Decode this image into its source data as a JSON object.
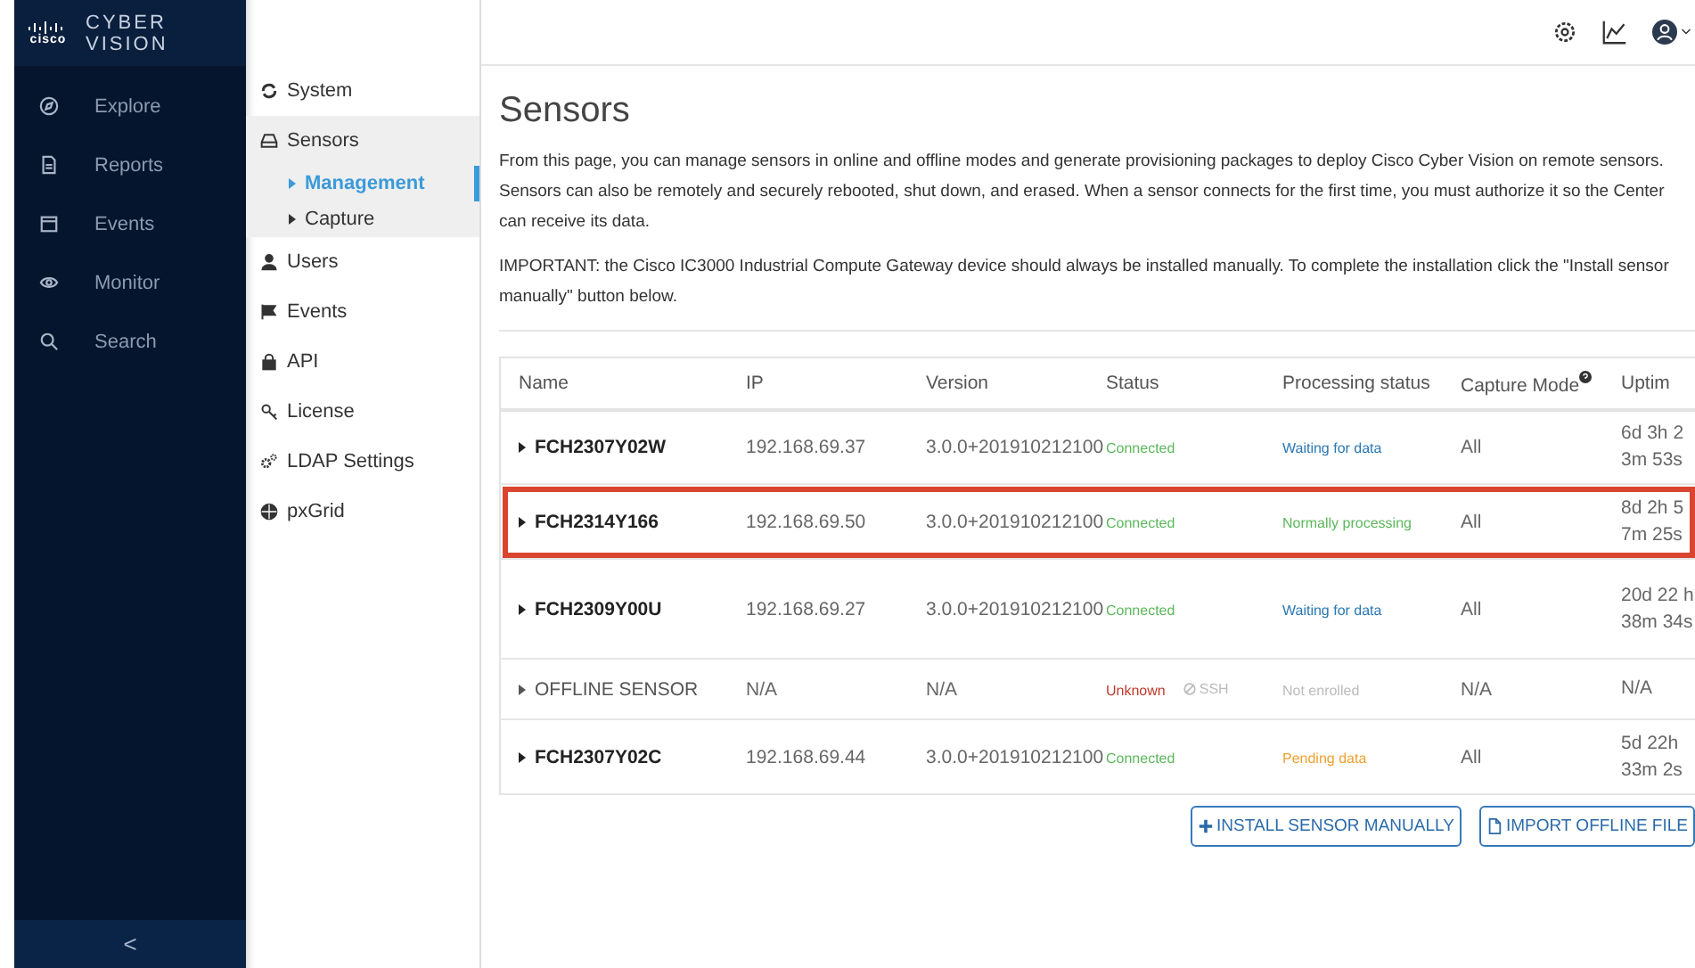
{
  "brand": {
    "logo": "cisco",
    "product": "CYBER VISION"
  },
  "nav": [
    {
      "label": "Explore"
    },
    {
      "label": "Reports"
    },
    {
      "label": "Events"
    },
    {
      "label": "Monitor"
    },
    {
      "label": "Search"
    }
  ],
  "collapse": "<",
  "settings_menu": [
    {
      "label": "System",
      "selected": false
    },
    {
      "label": "Sensors",
      "selected": false,
      "children": [
        {
          "label": "Management",
          "selected": true
        },
        {
          "label": "Capture",
          "selected": false
        }
      ]
    },
    {
      "label": "Users",
      "selected": false
    },
    {
      "label": "Events",
      "selected": false
    },
    {
      "label": "API",
      "selected": false
    },
    {
      "label": "License",
      "selected": false
    },
    {
      "label": "LDAP Settings",
      "selected": false
    },
    {
      "label": "pxGrid",
      "selected": false
    }
  ],
  "page": {
    "title": "Sensors",
    "paragraphs": [
      "From this page, you can manage sensors in online and offline modes and generate provisioning packages to deploy Cisco Cyber Vision on remote sensors. Sensors can also be remotely and securely rebooted, shut down, and erased. When a sensor connects for the first time, you must authorize it so the Center can receive its data.",
      "IMPORTANT: the Cisco IC3000 Industrial Compute Gateway device should always be installed manually. To complete the installation click the \"Install sensor manually\" button below."
    ]
  },
  "table": {
    "columns": [
      "Name",
      "IP",
      "Version",
      "Status",
      "Processing status",
      "Capture Mode",
      "Uptim"
    ],
    "rows": [
      {
        "name": "FCH2307Y02W",
        "offline": false,
        "highlighted": false,
        "ip": "192.168.69.37",
        "version": "3.0.0+201910212100",
        "status": {
          "text": "Connected",
          "kind": "ok"
        },
        "processing": {
          "text": "Waiting for data",
          "kind": "waiting"
        },
        "capture": "All",
        "uptime": "6d 3h 2 3m 53s"
      },
      {
        "name": "FCH2314Y166",
        "offline": false,
        "highlighted": true,
        "ip": "192.168.69.50",
        "version": "3.0.0+201910212100",
        "status": {
          "text": "Connected",
          "kind": "ok"
        },
        "processing": {
          "text": "Normally processing",
          "kind": "normal"
        },
        "capture": "All",
        "uptime": "8d 2h 5 7m 25s"
      },
      {
        "name": "FCH2309Y00U",
        "offline": false,
        "highlighted": false,
        "ip": "192.168.69.27",
        "version": "3.0.0+201910212100",
        "status": {
          "text": "Connected",
          "kind": "ok"
        },
        "processing": {
          "text": "Waiting for data",
          "kind": "waiting"
        },
        "capture": "All",
        "uptime": "20d 22 h 38m 34s"
      },
      {
        "name": "OFFLINE SENSOR",
        "offline": true,
        "highlighted": false,
        "ip": "N/A",
        "version": "N/A",
        "status": {
          "text": "Unknown",
          "kind": "unknown"
        },
        "badge": "SSH",
        "processing": {
          "text": "Not enrolled",
          "kind": "none"
        },
        "capture": "N/A",
        "uptime": "N/A"
      },
      {
        "name": "FCH2307Y02C",
        "offline": false,
        "highlighted": false,
        "ip": "192.168.69.44",
        "version": "3.0.0+201910212100",
        "status": {
          "text": "Connected",
          "kind": "ok"
        },
        "processing": {
          "text": "Pending data",
          "kind": "pending"
        },
        "capture": "All",
        "uptime": "5d 22h 33m 2s"
      }
    ]
  },
  "buttons": [
    {
      "label": "INSTALL SENSOR MANUALLY"
    },
    {
      "label": "IMPORT OFFLINE FILE"
    }
  ]
}
